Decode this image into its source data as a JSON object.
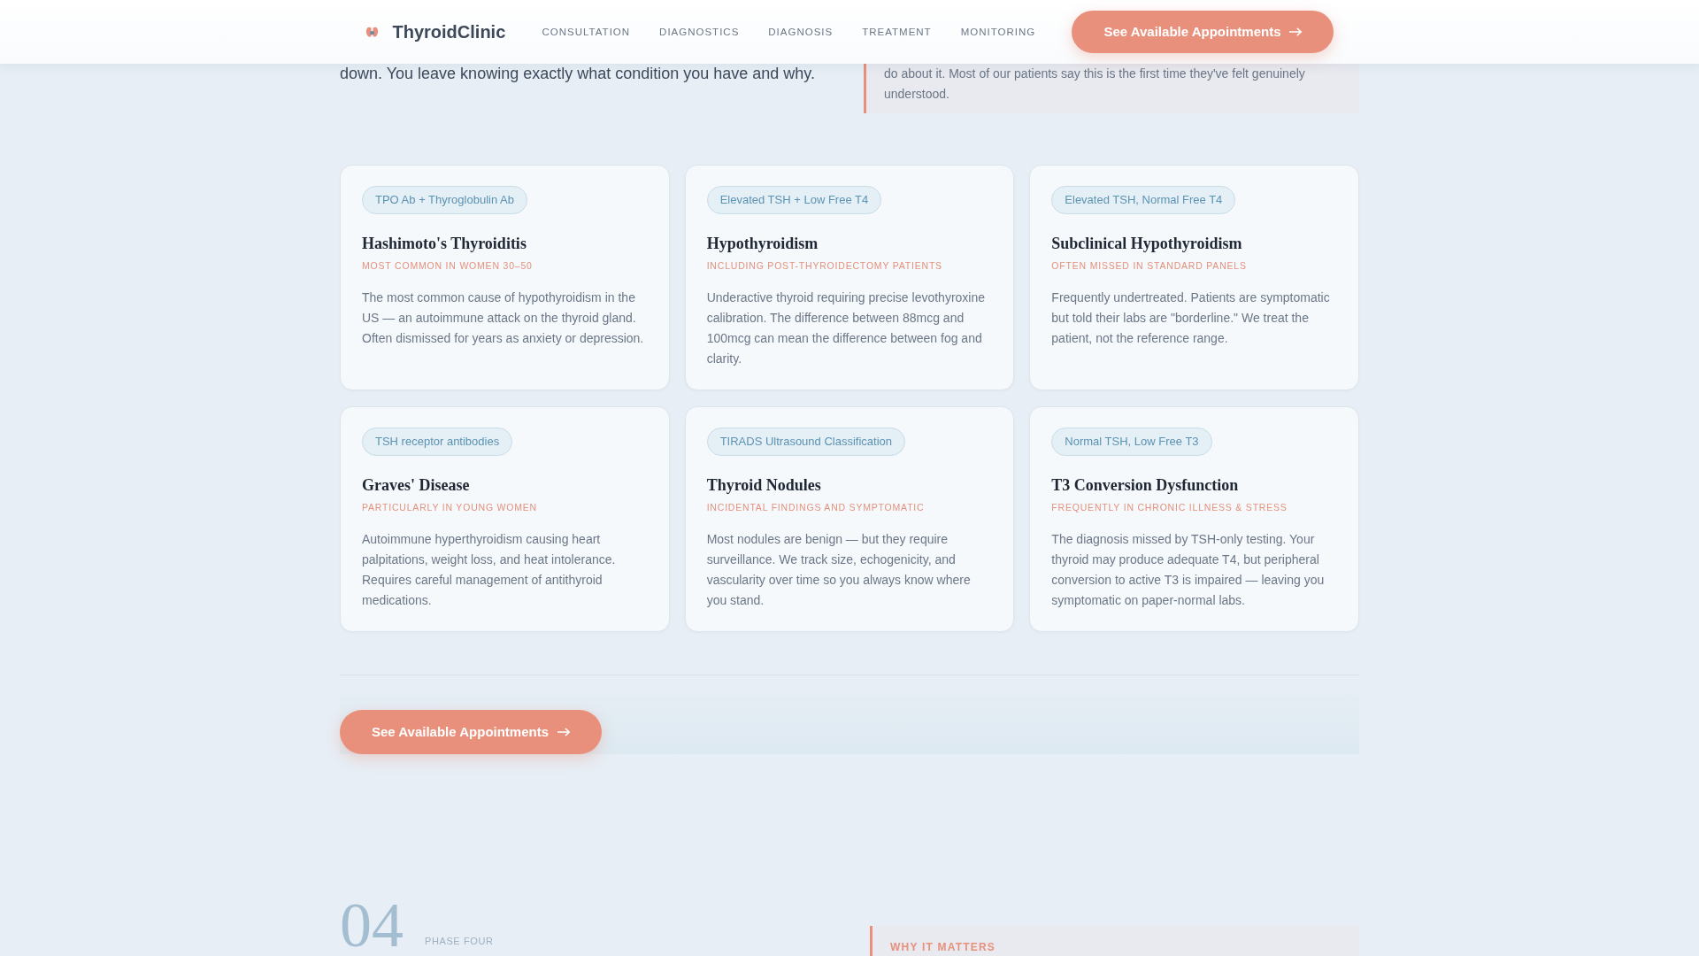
{
  "header": {
    "brand": "ThyroidClinic",
    "nav": [
      "CONSULTATION",
      "DIAGNOSTICS",
      "DIAGNOSIS",
      "TREATMENT",
      "MONITORING"
    ],
    "button": "See Available Appointments"
  },
  "intro": {
    "text": "down. You leave knowing exactly what condition you have and why.",
    "quote": "do about it. Most of our patients say this is the first time they've felt genuinely understood."
  },
  "conditions": [
    {
      "tag": "TPO Ab + Thyroglobulin Ab",
      "title": "Hashimoto's Thyroiditis",
      "subtitle": "MOST COMMON IN WOMEN 30–50",
      "description": "The most common cause of hypothyroidism in the US — an autoimmune attack on the thyroid gland. Often dismissed for years as anxiety or depression."
    },
    {
      "tag": "Elevated TSH + Low Free T4",
      "title": "Hypothyroidism",
      "subtitle": "INCLUDING POST-THYROIDECTOMY PATIENTS",
      "description": "Underactive thyroid requiring precise levothyroxine calibration. The difference between 88mcg and 100mcg can mean the difference between fog and clarity."
    },
    {
      "tag": "Elevated TSH, Normal Free T4",
      "title": "Subclinical Hypothyroidism",
      "subtitle": "OFTEN MISSED IN STANDARD PANELS",
      "description": "Frequently undertreated. Patients are symptomatic but told their labs are \"borderline.\" We treat the patient, not the reference range."
    },
    {
      "tag": "TSH receptor antibodies",
      "title": "Graves' Disease",
      "subtitle": "PARTICULARLY IN YOUNG WOMEN",
      "description": "Autoimmune hyperthyroidism causing heart palpitations, weight loss, and heat intolerance. Requires careful management of antithyroid medications."
    },
    {
      "tag": "TIRADS Ultrasound Classification",
      "title": "Thyroid Nodules",
      "subtitle": "INCIDENTAL FINDINGS AND SYMPTOMATIC",
      "description": "Most nodules are benign — but they require surveillance. We track size, echogenicity, and vascularity over time so you always know where you stand."
    },
    {
      "tag": "Normal TSH, Low Free T3",
      "title": "T3 Conversion Dysfunction",
      "subtitle": "FREQUENTLY IN CHRONIC ILLNESS & STRESS",
      "description": "The diagnosis missed by TSH-only testing. Your thyroid may produce adequate T4, but peripheral conversion to active T3 is impaired — leaving you symptomatic on paper-normal labs."
    }
  ],
  "cta": {
    "button": "See Available Appointments"
  },
  "next_phase": {
    "number": "04",
    "label": "PHASE FOUR",
    "aside_heading": "WHY IT MATTERS"
  }
}
